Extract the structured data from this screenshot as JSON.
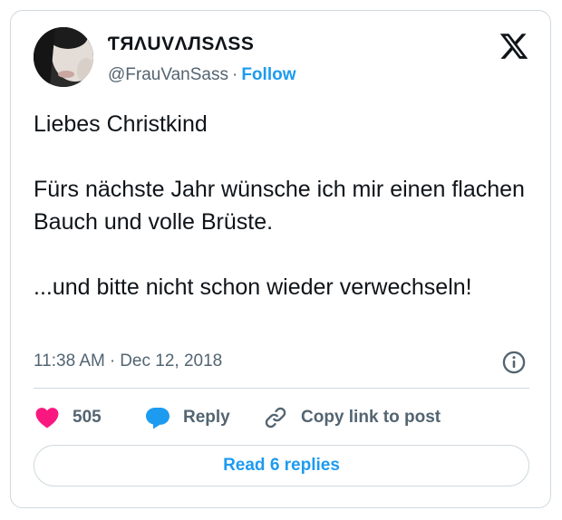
{
  "author": {
    "display_name": "ƬЯΛUVΛЛSΛSS",
    "handle": "@FrauVanSass",
    "separator": "·",
    "follow_label": "Follow"
  },
  "tweet": {
    "text": "Liebes Christkind\n\nFürs nächste Jahr wünsche ich mir einen flachen Bauch und volle Brüste.\n\n...und bitte nicht schon wieder verwechseln!",
    "time": "11:38 AM",
    "separator": "·",
    "date": "Dec 12, 2018"
  },
  "actions": {
    "like_count": "505",
    "reply_label": "Reply",
    "copy_link_label": "Copy link to post"
  },
  "replies_button_label": "Read 6 replies",
  "icons": {
    "like": "heart-icon",
    "reply": "speech-bubble-icon",
    "copy": "link-icon",
    "info": "info-icon",
    "brand": "x-logo-icon"
  },
  "colors": {
    "accent": "#1d9bf0",
    "like": "#f91880",
    "text_primary": "#0f1419",
    "text_secondary": "#536471",
    "border": "#cfd9de"
  }
}
